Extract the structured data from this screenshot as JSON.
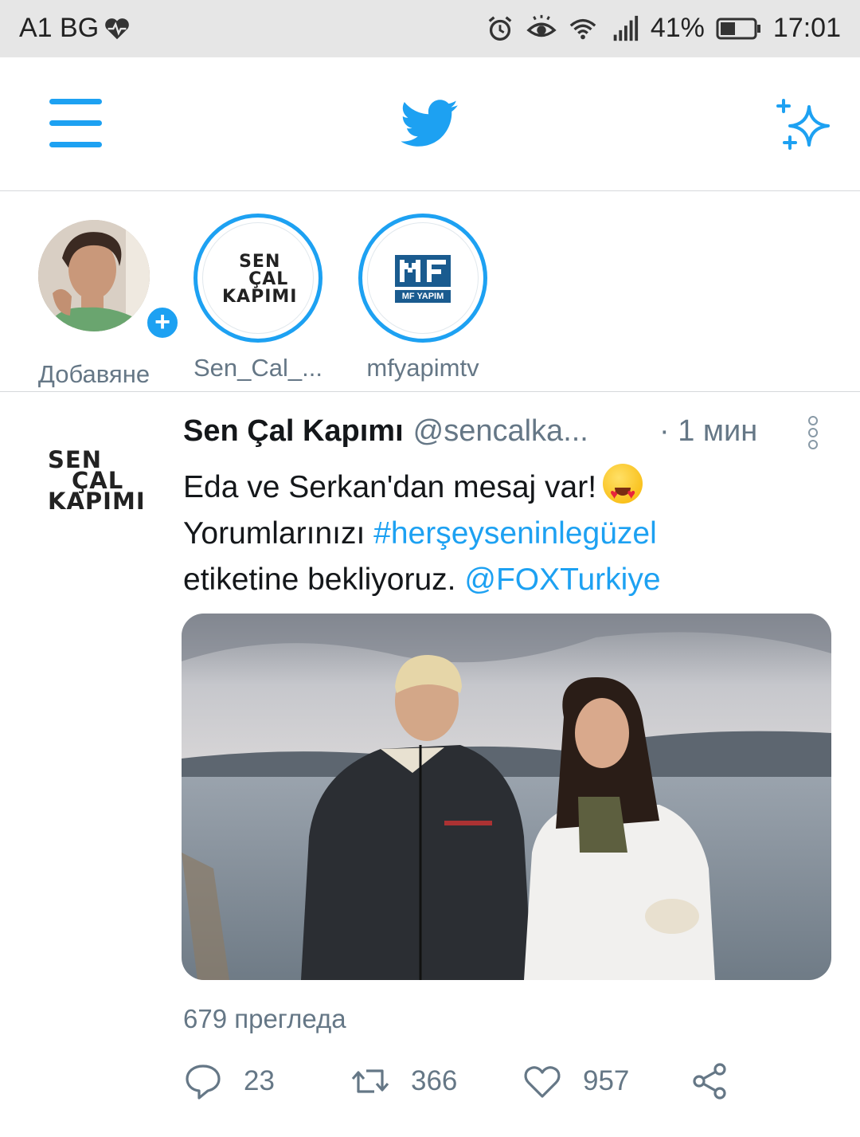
{
  "status_bar": {
    "carrier": "A1 BG",
    "battery": "41%",
    "time": "17:01"
  },
  "app": {
    "accent": "#1da1f2"
  },
  "fleets": [
    {
      "label": "Добавяне"
    },
    {
      "label": "Sen_Cal_...",
      "logo_lines": [
        "SEN",
        "ÇAL",
        "KAPIMI"
      ]
    },
    {
      "label": "mfyapimtv",
      "logo_text": "MF YAPIM"
    }
  ],
  "tweet": {
    "avatar_lines": [
      "SEN",
      "ÇAL",
      "KAPIMI"
    ],
    "name": "Sen Çal Kapımı",
    "handle": "@sencalka...",
    "time": "· 1 мин",
    "text_1": "Eda ve Serkan'dan mesaj var!",
    "text_2": "Yorumlarınızı",
    "hashtag": "#herşeyseninlegüzel",
    "text_3": "etiketine bekliyoruz.",
    "mention": "@FOXTurkiye",
    "views": "679 прегледа",
    "replies": "23",
    "retweets": "366",
    "likes": "957"
  }
}
